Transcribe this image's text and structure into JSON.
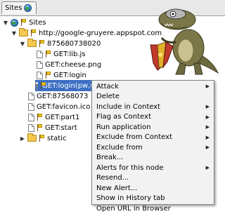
{
  "tab": {
    "label": "Sites",
    "icon": "globe-icon"
  },
  "tree": {
    "root": "Sites",
    "site": "http://google-gruyere.appspot.com",
    "folder_id": "875680738020",
    "items": {
      "get_lib": "GET:lib.js",
      "get_cheese": "GET:cheese.png",
      "get_login": "GET:login",
      "get_login_selected": "GET:login(pw,uid)",
      "get_875": "GET:87568073",
      "get_favicon": "GET:favicon.ico",
      "get_part1": "GET:part1",
      "get_start": "GET:start",
      "static": "static"
    }
  },
  "menu": {
    "items": [
      {
        "label": "Attack",
        "submenu": true
      },
      {
        "label": "Delete",
        "submenu": false
      },
      {
        "label": "Include in Context",
        "submenu": true
      },
      {
        "label": "Flag as Context",
        "submenu": true
      },
      {
        "label": "Run application",
        "submenu": true
      },
      {
        "label": "Exclude from Context",
        "submenu": true
      },
      {
        "label": "Exclude from",
        "submenu": true
      },
      {
        "label": "Break...",
        "submenu": false
      },
      {
        "label": "Alerts for this node",
        "submenu": true
      },
      {
        "label": "Resend...",
        "submenu": false
      },
      {
        "label": "New Alert...",
        "submenu": false
      },
      {
        "label": "Show in History tab",
        "submenu": false
      },
      {
        "label": "Open URL in Browser",
        "submenu": false
      }
    ]
  },
  "colors": {
    "selection": "#3d6fc4",
    "folder": "#f5c850",
    "flag": "#f2c51a"
  }
}
